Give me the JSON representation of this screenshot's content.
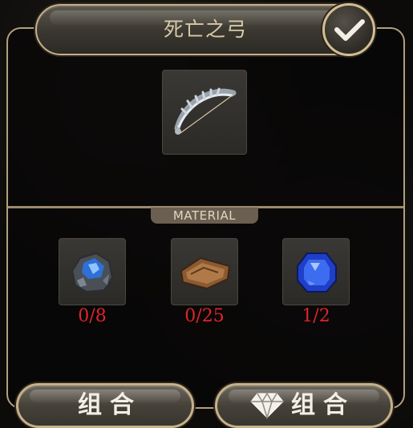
{
  "header": {
    "title": "死亡之弓",
    "confirm_icon": "checkmark-icon"
  },
  "result_item": {
    "icon": "bow-icon"
  },
  "materials": {
    "section_label": "MATERIAL",
    "items": [
      {
        "icon": "blue-ore-icon",
        "count": "0/8"
      },
      {
        "icon": "leather-scroll-icon",
        "count": "0/25"
      },
      {
        "icon": "sapphire-gem-icon",
        "count": "1/2"
      }
    ],
    "count_color": "#e0242a"
  },
  "actions": {
    "combine_label": "组合",
    "premium_combine_label": "组合",
    "premium_icon": "diamond-icon"
  }
}
